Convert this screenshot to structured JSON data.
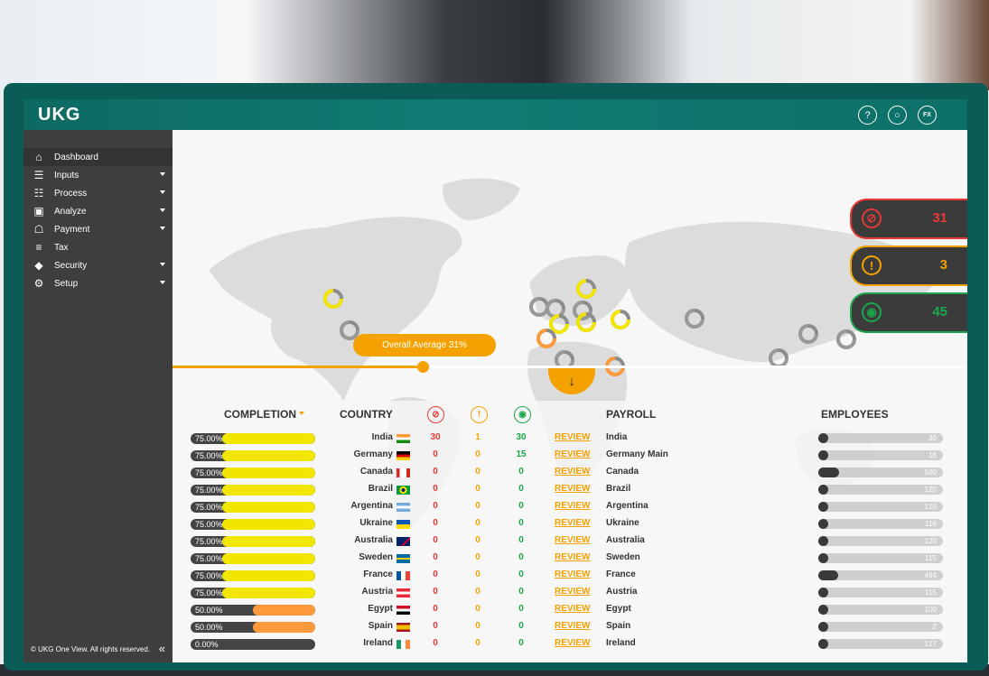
{
  "app": {
    "logo": "UKG",
    "top_icons": [
      {
        "name": "help-icon",
        "glyph": "?"
      },
      {
        "name": "globe-icon",
        "glyph": "○"
      },
      {
        "name": "fx-icon",
        "glyph": "FX"
      }
    ]
  },
  "sidebar": {
    "items": [
      {
        "label": "Dashboard",
        "icon": "home-icon",
        "glyph": "⌂",
        "expandable": false,
        "active": true
      },
      {
        "label": "Inputs",
        "icon": "inputs-icon",
        "glyph": "☰",
        "expandable": true,
        "active": false
      },
      {
        "label": "Process",
        "icon": "process-icon",
        "glyph": "☷",
        "expandable": true,
        "active": false
      },
      {
        "label": "Analyze",
        "icon": "analyze-icon",
        "glyph": "▣",
        "expandable": true,
        "active": false
      },
      {
        "label": "Payment",
        "icon": "payment-icon",
        "glyph": "☖",
        "expandable": true,
        "active": false
      },
      {
        "label": "Tax",
        "icon": "tax-icon",
        "glyph": "≡",
        "expandable": false,
        "active": false
      },
      {
        "label": "Security",
        "icon": "shield-icon",
        "glyph": "◆",
        "expandable": true,
        "active": false
      },
      {
        "label": "Setup",
        "icon": "gears-icon",
        "glyph": "⚙",
        "expandable": true,
        "active": false
      }
    ],
    "copyright": "© UKG One View. All rights reserved.",
    "collapse_glyph": "«"
  },
  "map": {
    "overall_average_label": "Overall Average 31%",
    "overall_average_value": 0.31,
    "down_glyph": "↓"
  },
  "stats": [
    {
      "name": "stat-errors",
      "icon": "blocked-icon",
      "glyph": "⊘",
      "value": "31",
      "color": "#e53935"
    },
    {
      "name": "stat-warnings",
      "icon": "warning-icon",
      "glyph": "!",
      "value": "3",
      "color": "#f5a200"
    },
    {
      "name": "stat-reviewed",
      "icon": "eye-icon",
      "glyph": "◉",
      "value": "45",
      "color": "#1aa64a"
    }
  ],
  "table": {
    "headers": {
      "completion": "COMPLETION",
      "country": "COUNTRY",
      "payroll": "PAYROLL",
      "employees": "EMPLOYEES"
    },
    "review_label": "REVIEW",
    "rows": [
      {
        "completion_text": "75.00%",
        "completion": 0.75,
        "country": "India",
        "flag": "india",
        "errors": "30",
        "warnings": "1",
        "ok": "30",
        "payroll": "India",
        "employees": "30",
        "employees_fraction": 0.06
      },
      {
        "completion_text": "75.00%",
        "completion": 0.75,
        "country": "Germany",
        "flag": "germany",
        "errors": "0",
        "warnings": "0",
        "ok": "15",
        "payroll": "Germany Main",
        "employees": "18",
        "employees_fraction": 0.04
      },
      {
        "completion_text": "75.00%",
        "completion": 0.75,
        "country": "Canada",
        "flag": "canada",
        "errors": "0",
        "warnings": "0",
        "ok": "0",
        "payroll": "Canada",
        "employees": "500",
        "employees_fraction": 0.17
      },
      {
        "completion_text": "75.00%",
        "completion": 0.75,
        "country": "Brazil",
        "flag": "brazil",
        "errors": "0",
        "warnings": "0",
        "ok": "0",
        "payroll": "Brazil",
        "employees": "120",
        "employees_fraction": 0.04
      },
      {
        "completion_text": "75.00%",
        "completion": 0.75,
        "country": "Argentina",
        "flag": "argentina",
        "errors": "0",
        "warnings": "0",
        "ok": "0",
        "payroll": "Argentina",
        "employees": "120",
        "employees_fraction": 0.04
      },
      {
        "completion_text": "75.00%",
        "completion": 0.75,
        "country": "Ukraine",
        "flag": "ukraine",
        "errors": "0",
        "warnings": "0",
        "ok": "0",
        "payroll": "Ukraine",
        "employees": "116",
        "employees_fraction": 0.04
      },
      {
        "completion_text": "75.00%",
        "completion": 0.75,
        "country": "Australia",
        "flag": "australia",
        "errors": "0",
        "warnings": "0",
        "ok": "0",
        "payroll": "Australia",
        "employees": "120",
        "employees_fraction": 0.04
      },
      {
        "completion_text": "75.00%",
        "completion": 0.75,
        "country": "Sweden",
        "flag": "sweden",
        "errors": "0",
        "warnings": "0",
        "ok": "0",
        "payroll": "Sweden",
        "employees": "115",
        "employees_fraction": 0.04
      },
      {
        "completion_text": "75.00%",
        "completion": 0.75,
        "country": "France",
        "flag": "france",
        "errors": "0",
        "warnings": "0",
        "ok": "0",
        "payroll": "France",
        "employees": "494",
        "employees_fraction": 0.16
      },
      {
        "completion_text": "75.00%",
        "completion": 0.75,
        "country": "Austria",
        "flag": "austria",
        "errors": "0",
        "warnings": "0",
        "ok": "0",
        "payroll": "Austria",
        "employees": "115",
        "employees_fraction": 0.04
      },
      {
        "completion_text": "50.00%",
        "completion": 0.5,
        "country": "Egypt",
        "flag": "egypt",
        "errors": "0",
        "warnings": "0",
        "ok": "0",
        "payroll": "Egypt",
        "employees": "100",
        "employees_fraction": 0.04
      },
      {
        "completion_text": "50.00%",
        "completion": 0.5,
        "country": "Spain",
        "flag": "spain",
        "errors": "0",
        "warnings": "0",
        "ok": "0",
        "payroll": "Spain",
        "employees": "2",
        "employees_fraction": 0.02
      },
      {
        "completion_text": "0.00%",
        "completion": 0.0,
        "country": "Ireland",
        "flag": "ireland",
        "errors": "0",
        "warnings": "0",
        "ok": "0",
        "payroll": "Ireland",
        "employees": "127",
        "employees_fraction": 0.04
      }
    ]
  },
  "colors": {
    "brand_teal": "#0f7b72",
    "accent_orange": "#f5a200",
    "full_yellow": "#f2e600",
    "half_orange": "#ff9a3c",
    "error_red": "#e53935",
    "ok_green": "#1aa64a"
  }
}
